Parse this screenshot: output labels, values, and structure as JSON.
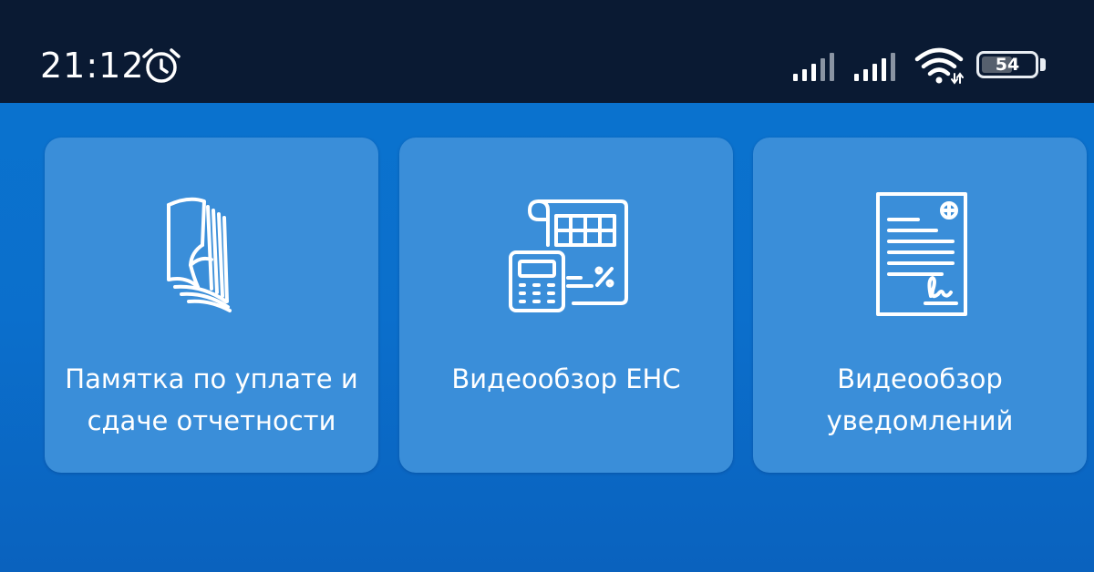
{
  "status_bar": {
    "time": "21:12",
    "battery_level": "54",
    "icons": [
      "alarm-icon",
      "cellular-signal-icon",
      "cellular-signal-icon",
      "wifi-icon",
      "battery-icon"
    ]
  },
  "cards": [
    {
      "title": "Памятка по уплате и сдаче отчетности",
      "icon": "booklet-icon"
    },
    {
      "title": "Видеообзор ЕНС",
      "icon": "calculator-document-icon"
    },
    {
      "title": "Видеообзор уведомлений",
      "icon": "signed-document-icon"
    }
  ],
  "colors": {
    "status_bar": "#0a1a33",
    "background": "#0b6fcc",
    "card": "#3a8ed9",
    "foreground": "#ffffff"
  }
}
